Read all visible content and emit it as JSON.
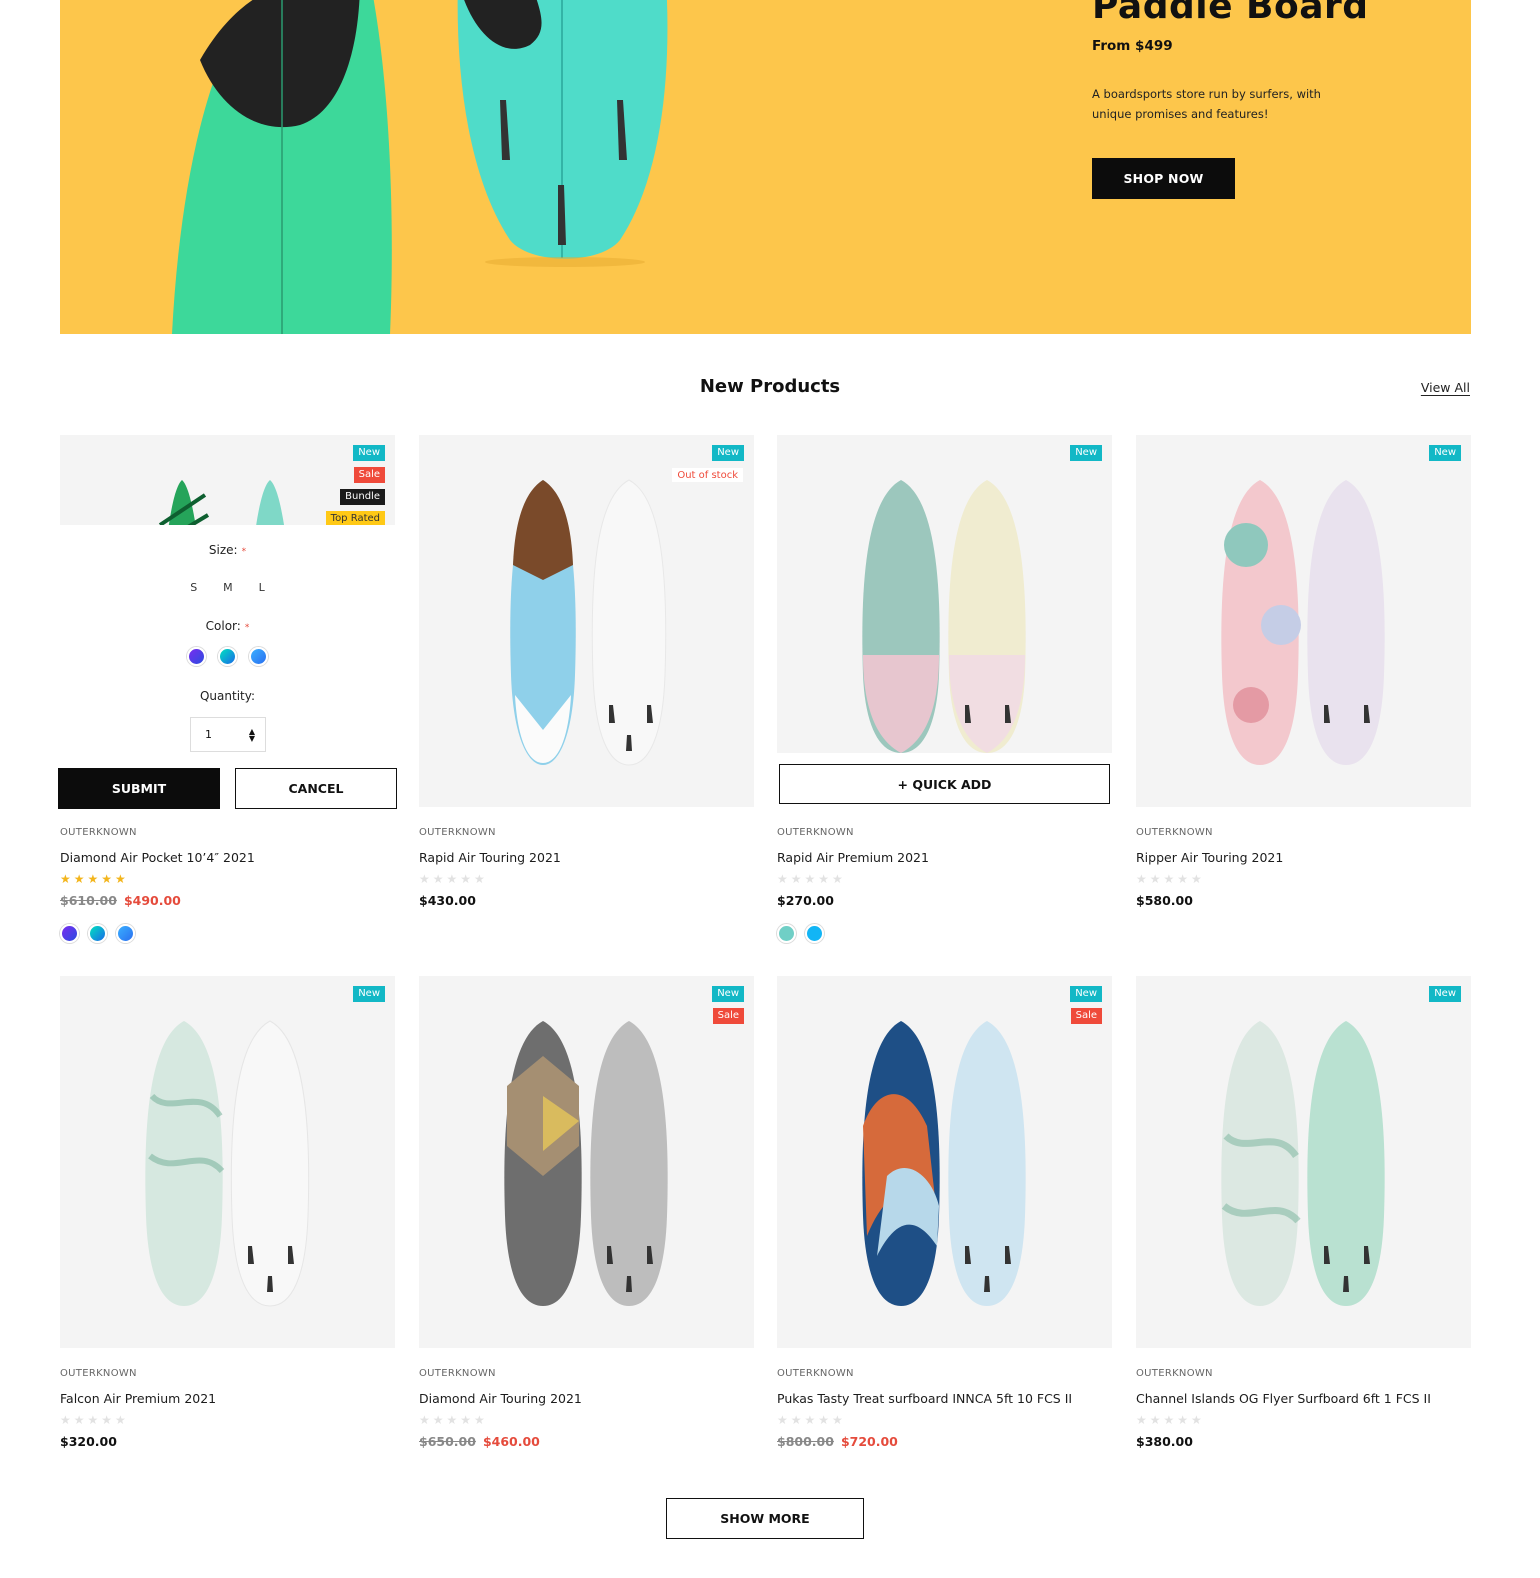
{
  "hero": {
    "title": "Paddle Board",
    "price": "From $499",
    "description": "A boardsports store run by surfers, with unique promises and features!",
    "cta": "SHOP NOW",
    "background": "#fdc64b"
  },
  "section": {
    "title": "New Products",
    "view_all": "View All"
  },
  "quick_add_form": {
    "size_label": "Size:",
    "required_mark": "*",
    "sizes": [
      "S",
      "M",
      "L"
    ],
    "color_label": "Color:",
    "quantity_label": "Quantity:",
    "quantity_value": "1",
    "submit": "SUBMIT",
    "cancel": "CANCEL"
  },
  "quick_add_label": "+ QUICK ADD",
  "products": [
    {
      "vendor": "OUTERKNOWN",
      "name": "Diamond Air Pocket 10’4″ 2021",
      "badges": [
        "New",
        "Sale",
        "Bundle",
        "Top Rated"
      ],
      "rating": 5,
      "price_old": "$610.00",
      "price": "$490.00",
      "swatch_icons": [
        "purple-gradient-swatch",
        "teal-gradient-swatch",
        "blue-gradient-swatch"
      ]
    },
    {
      "vendor": "OUTERKNOWN",
      "name": "Rapid Air Touring 2021",
      "badges": [
        "New",
        "Out of stock"
      ],
      "rating": 0,
      "price": "$430.00"
    },
    {
      "vendor": "OUTERKNOWN",
      "name": "Rapid Air Premium 2021",
      "badges": [
        "New"
      ],
      "rating": 0,
      "price": "$270.00",
      "swatch_icons": [
        "mint-swatch",
        "sky-swatch"
      ]
    },
    {
      "vendor": "OUTERKNOWN",
      "name": "Ripper Air Touring 2021",
      "badges": [
        "New"
      ],
      "rating": 0,
      "price": "$580.00"
    },
    {
      "vendor": "OUTERKNOWN",
      "name": "Falcon Air Premium 2021",
      "badges": [
        "New"
      ],
      "rating": 0,
      "price": "$320.00"
    },
    {
      "vendor": "OUTERKNOWN",
      "name": "Diamond Air Touring 2021",
      "badges": [
        "New",
        "Sale"
      ],
      "rating": 0,
      "price_old": "$650.00",
      "price": "$460.00"
    },
    {
      "vendor": "OUTERKNOWN",
      "name": "Pukas Tasty Treat surfboard INNCA 5ft 10 FCS II",
      "badges": [
        "New",
        "Sale"
      ],
      "rating": 0,
      "price_old": "$800.00",
      "price": "$720.00"
    },
    {
      "vendor": "OUTERKNOWN",
      "name": "Channel Islands OG Flyer Surfboard 6ft 1 FCS II",
      "badges": [
        "New"
      ],
      "rating": 0,
      "price": "$380.00"
    }
  ],
  "show_more": "SHOW MORE",
  "colors": {
    "badge_new": "#12b8c6",
    "badge_sale": "#ef4a3a",
    "sale_price": "#e54b3c",
    "star": "#f3b51c"
  }
}
